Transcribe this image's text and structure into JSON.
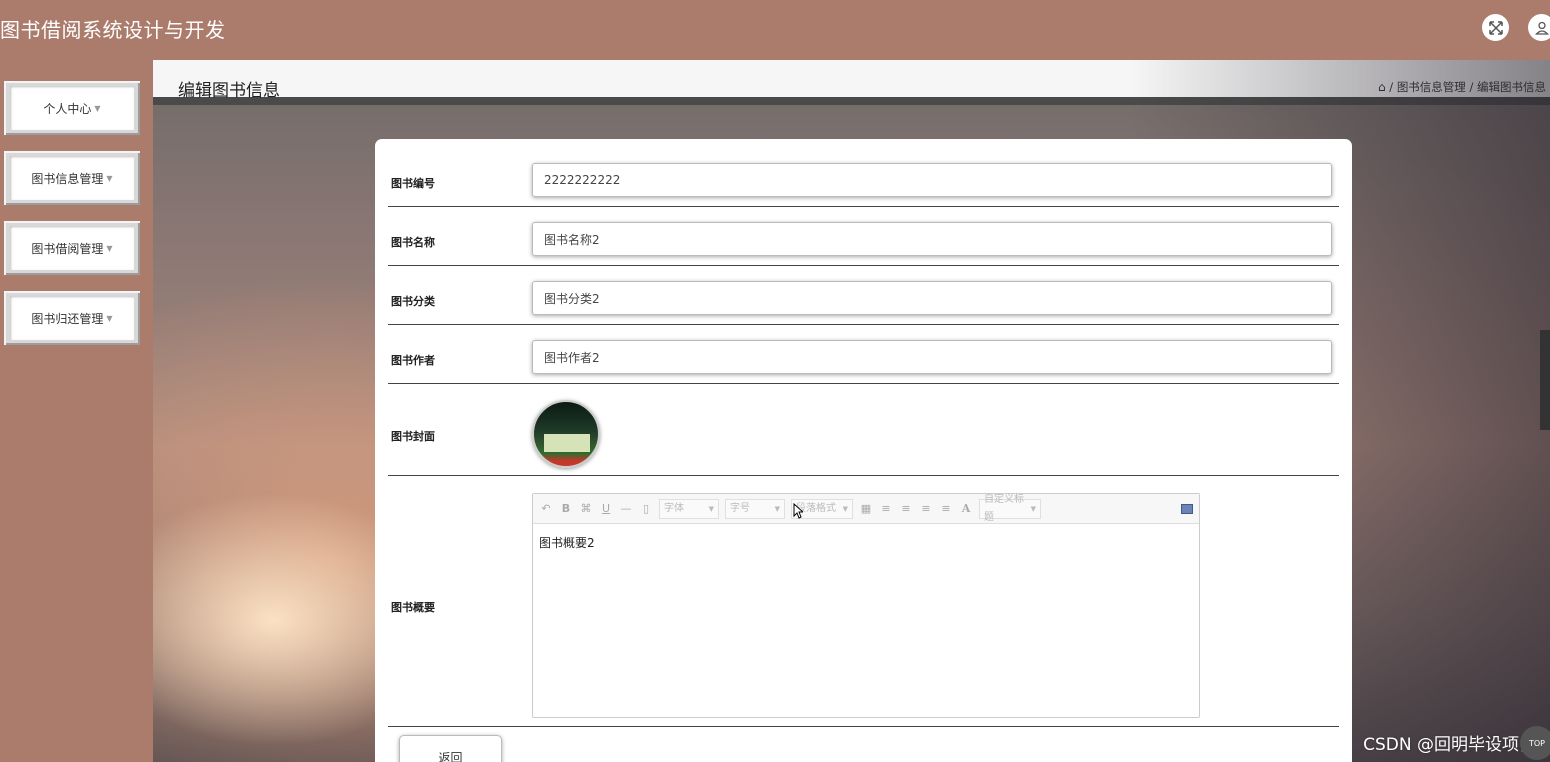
{
  "header": {
    "app_title": "图书借阅系统设计与开发",
    "fullscreen_icon": "fullscreen-icon",
    "user_icon": "user-icon"
  },
  "sidebar": {
    "items": [
      {
        "label": "个人中心"
      },
      {
        "label": "图书信息管理"
      },
      {
        "label": "图书借阅管理"
      },
      {
        "label": "图书归还管理"
      }
    ]
  },
  "page": {
    "title": "编辑图书信息",
    "breadcrumb": [
      "图书信息管理",
      "编辑图书信息"
    ]
  },
  "form": {
    "book_no": {
      "label": "图书编号",
      "value": "2222222222"
    },
    "book_name": {
      "label": "图书名称",
      "value": "图书名称2"
    },
    "category": {
      "label": "图书分类",
      "value": "图书分类2"
    },
    "author": {
      "label": "图书作者",
      "value": "图书作者2"
    },
    "cover": {
      "label": "图书封面"
    },
    "summary": {
      "label": "图书概要",
      "value": "图书概要2"
    },
    "back_label": "返回"
  },
  "editor_toolbar": {
    "font_family": "字体",
    "font_size": "字号",
    "paragraph_format": "段落格式",
    "custom_title": "自定义标题"
  },
  "watermark": "CSDN @回明毕设项目",
  "back_to_top": "TOP"
}
